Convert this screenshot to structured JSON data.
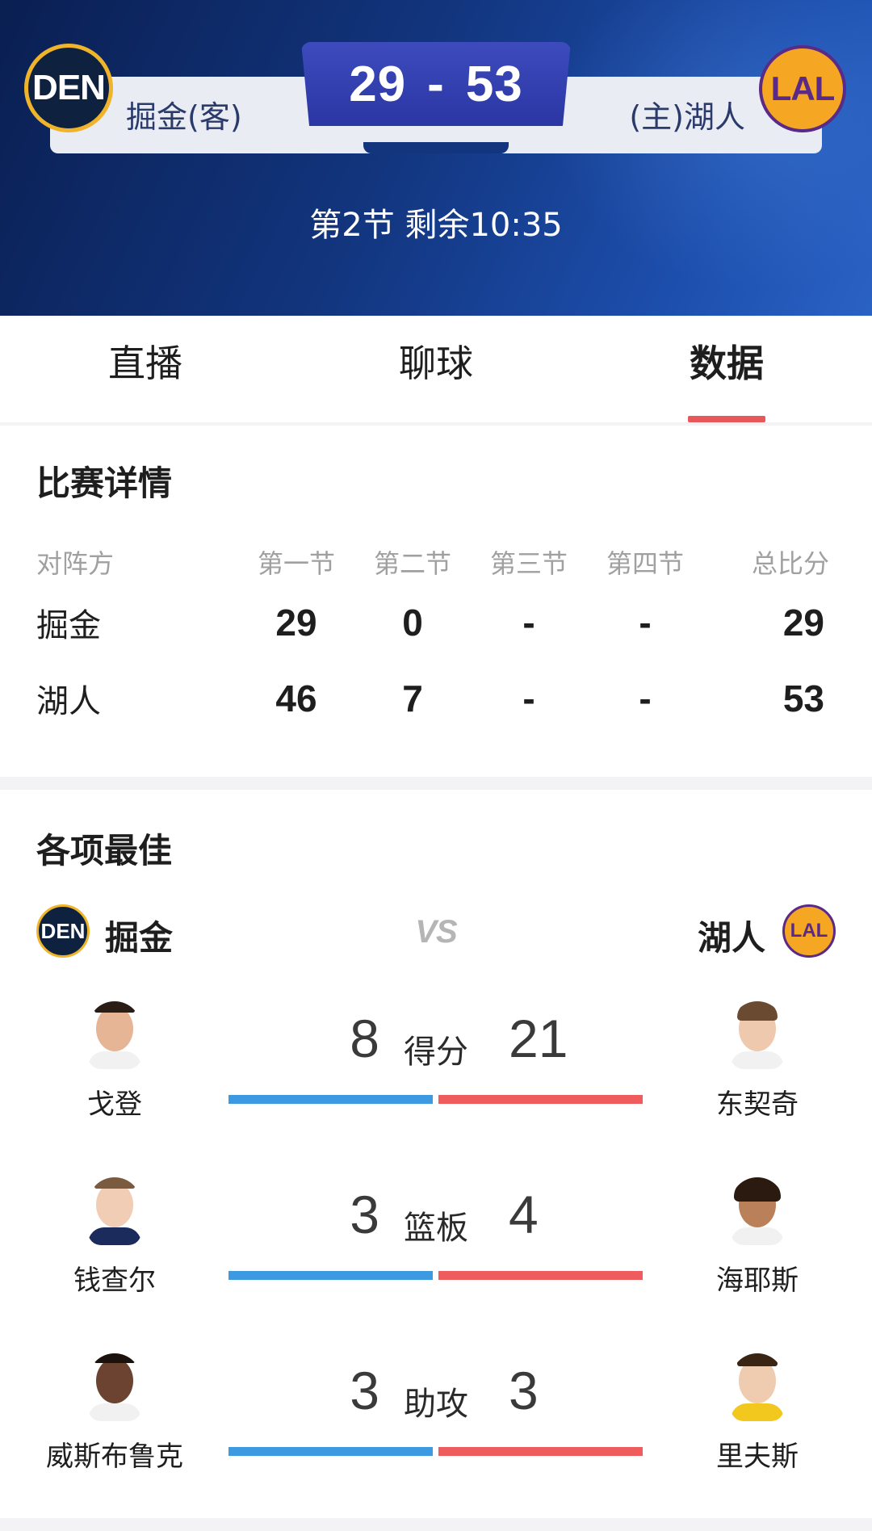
{
  "header": {
    "away_logo": "DEN",
    "home_logo": "LAL",
    "away_name": "掘金(客)",
    "home_name": "(主)湖人",
    "away_score": "29",
    "score_sep": "-",
    "home_score": "53",
    "clock": "第2节 剩余10:35",
    "colors": {
      "bg": "#12357e",
      "score_box": "#2b36a3"
    }
  },
  "tabs": [
    {
      "label": "直播",
      "active": false
    },
    {
      "label": "聊球",
      "active": false
    },
    {
      "label": "数据",
      "active": true
    }
  ],
  "match_details": {
    "title": "比赛详情",
    "headers": [
      "对阵方",
      "第一节",
      "第二节",
      "第三节",
      "第四节",
      "总比分"
    ],
    "rows": [
      {
        "team": "掘金",
        "q": [
          "29",
          "0",
          "-",
          "-"
        ],
        "total": "29"
      },
      {
        "team": "湖人",
        "q": [
          "46",
          "7",
          "-",
          "-"
        ],
        "total": "53"
      }
    ]
  },
  "leaders": {
    "title": "各项最佳",
    "left_team": "掘金",
    "right_team": "湖人",
    "left_logo": "DEN",
    "right_logo": "LAL",
    "vs": "VS",
    "stats": [
      {
        "label": "得分",
        "left_player": "戈登",
        "left_value": "8",
        "right_player": "东契奇",
        "right_value": "21"
      },
      {
        "label": "篮板",
        "left_player": "钱查尔",
        "left_value": "3",
        "right_player": "海耶斯",
        "right_value": "4"
      },
      {
        "label": "助攻",
        "left_player": "威斯布鲁克",
        "left_value": "3",
        "right_player": "里夫斯",
        "right_value": "3"
      }
    ],
    "colors": {
      "left_bar": "#3d9ae0",
      "right_bar": "#ee5c5e",
      "accent": "#e8575a"
    }
  }
}
